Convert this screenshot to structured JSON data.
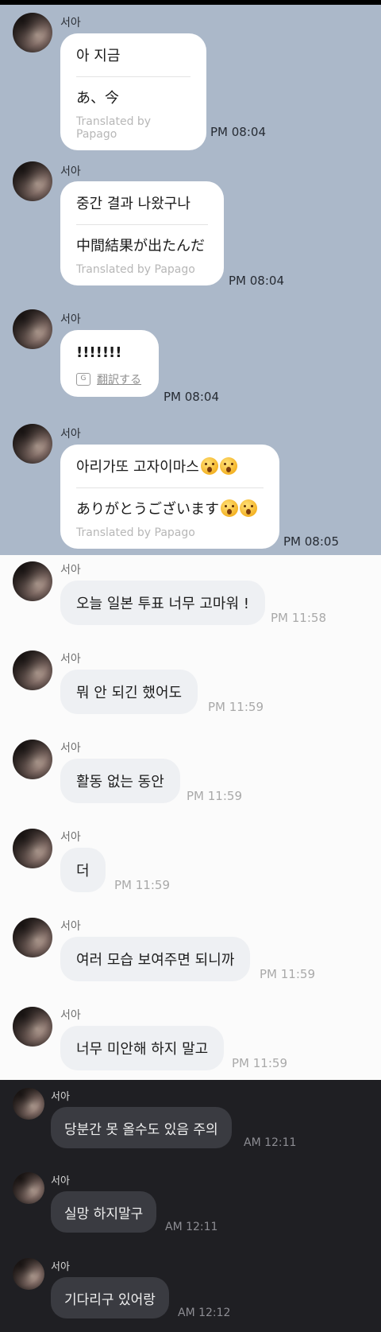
{
  "line_chat": {
    "messages": [
      {
        "sender": "서아",
        "original": "아 지금",
        "translation": "あ、今",
        "translated_by": "Translated by Papago",
        "time": "PM 08:04"
      },
      {
        "sender": "서아",
        "original": "중간 결과 나왔구나",
        "translation": "中間結果が出たんだ",
        "translated_by": "Translated by Papago",
        "time": "PM 08:04"
      },
      {
        "sender": "서아",
        "original": "!!!!!!!",
        "translate_button": "翻訳する",
        "time": "PM 08:04"
      },
      {
        "sender": "서아",
        "original": "아리가또 고자이마스",
        "original_emoji": "astonished-face x2",
        "translation": "ありがとうございます",
        "translation_emoji": "astonished-face x2",
        "translated_by": "Translated by Papago",
        "time": "PM 08:05"
      }
    ]
  },
  "light_chat": {
    "messages": [
      {
        "sender": "서아",
        "text": "오늘 일본 투표 너무 고마워 !",
        "time": "PM 11:58"
      },
      {
        "sender": "서아",
        "text": "뭐 안 되긴 했어도",
        "time": "PM 11:59"
      },
      {
        "sender": "서아",
        "text": "활동 없는 동안",
        "time": "PM 11:59"
      },
      {
        "sender": "서아",
        "text": "더",
        "time": "PM 11:59"
      },
      {
        "sender": "서아",
        "text": "여러 모습 보여주면 되니까",
        "time": "PM 11:59"
      },
      {
        "sender": "서아",
        "text": "너무 미안해 하지 말고",
        "time": "PM 11:59"
      }
    ]
  },
  "dark_chat": {
    "messages": [
      {
        "sender": "서아",
        "text": "당분간 못 올수도 있음 주의",
        "time": "AM 12:11"
      },
      {
        "sender": "서아",
        "text": "실망 하지말구",
        "time": "AM 12:11"
      },
      {
        "sender": "서아",
        "text": "기다리구 있어랑",
        "time": "AM 12:12"
      }
    ]
  }
}
